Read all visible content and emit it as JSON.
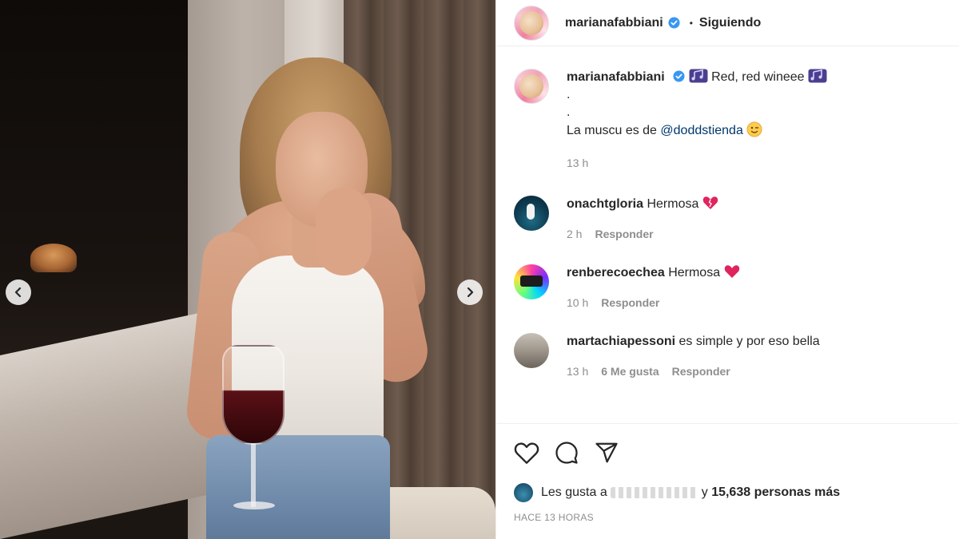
{
  "post": {
    "username": "marianafabbiani",
    "follow_separator": "•",
    "follow_label": "Siguiendo"
  },
  "caption": {
    "username": "marianafabbiani",
    "title": "Red, red wineee",
    "line2": ".",
    "line3": ".",
    "line4_prefix": "La muscu es de",
    "mention": "@doddstienda",
    "time": "13 h"
  },
  "comments": [
    {
      "username": "onachtgloria",
      "text": "Hermosa",
      "time": "2 h",
      "likes": "",
      "reply": "Responder"
    },
    {
      "username": "renberecoechea",
      "text": "Hermosa",
      "time": "10 h",
      "likes": "",
      "reply": "Responder"
    },
    {
      "username": "martachiapessoni",
      "text": "es simple y por eso bella",
      "time": "13 h",
      "likes": "6 Me gusta",
      "reply": "Responder"
    }
  ],
  "likes": {
    "prefix": "Les gusta a",
    "connector": "y",
    "count": "15,638 personas más"
  },
  "posted_ago": "HACE 13 HORAS",
  "icons": {
    "like": "heart-icon",
    "comment": "comment-bubble-icon",
    "share": "paper-plane-icon",
    "verified": "verified-badge-icon",
    "prev": "chevron-left-icon",
    "next": "chevron-right-icon"
  },
  "colors": {
    "verified": "#3897f0",
    "link": "#00376b",
    "muted": "#8e8e8e",
    "heart_red": "#e0245e"
  }
}
